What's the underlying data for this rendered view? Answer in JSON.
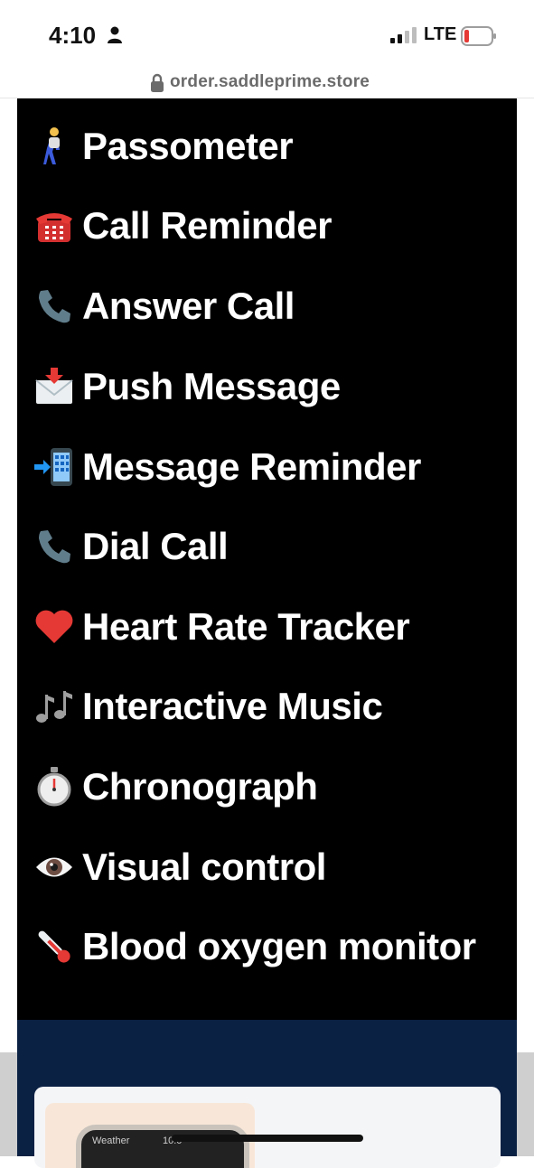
{
  "status_bar": {
    "time": "4:10",
    "network": "LTE",
    "icons": [
      "person-icon",
      "signal-icon",
      "battery-icon"
    ],
    "battery_color": "#e53935"
  },
  "browser": {
    "url": "order.saddleprime.store",
    "icon": "lock-icon"
  },
  "features": [
    {
      "emoji": "🚶",
      "icon": "person-walking-icon",
      "label": "Passometer"
    },
    {
      "emoji": "☎️",
      "icon": "telephone-icon",
      "label": "Call Reminder"
    },
    {
      "emoji": "📞",
      "icon": "phone-receiver-icon",
      "label": "Answer Call"
    },
    {
      "emoji": "📩",
      "icon": "envelope-arrow-icon",
      "label": "Push Message"
    },
    {
      "emoji": "📲",
      "icon": "mobile-arrow-icon",
      "label": "Message Reminder"
    },
    {
      "emoji": "📞",
      "icon": "phone-receiver-icon",
      "label": "Dial Call"
    },
    {
      "emoji": "❤️",
      "icon": "heart-icon",
      "label": "Heart Rate Tracker"
    },
    {
      "emoji": "🎶",
      "icon": "music-notes-icon",
      "label": "Interactive Music"
    },
    {
      "emoji": "⏱️",
      "icon": "stopwatch-icon",
      "label": "Chronograph"
    },
    {
      "emoji": "👁️",
      "icon": "eye-icon",
      "label": "Visual control"
    },
    {
      "emoji": "🌡️",
      "icon": "thermometer-icon",
      "label": "Blood oxygen monitor"
    }
  ],
  "product_card": {
    "watch_labels": [
      "Weather",
      "10:0"
    ]
  },
  "colors": {
    "panel_bg": "#000000",
    "navy_bg": "#0b2144",
    "feature_text": "#ffffff"
  }
}
